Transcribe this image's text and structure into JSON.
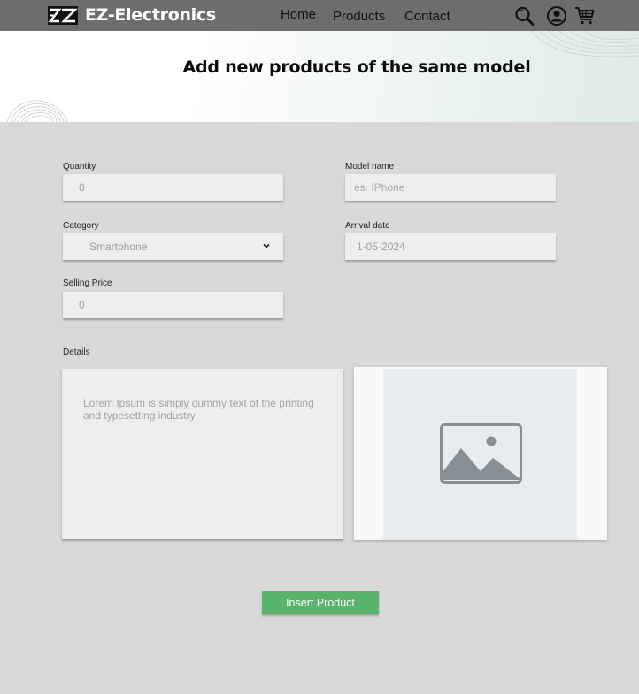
{
  "header": {
    "brand": "EZ-Electronics",
    "nav": {
      "home": "Home",
      "products": "Products",
      "contact": "Contact"
    },
    "icons": [
      "logo-icon",
      "search-icon",
      "user-icon",
      "cart-icon"
    ],
    "background_color": "#6d6d6d"
  },
  "hero": {
    "title": "Add new products of the same model"
  },
  "form": {
    "quantity": {
      "label": "Quantity",
      "value": "0"
    },
    "model_name": {
      "label": "Model name",
      "placeholder": "es. IPhone"
    },
    "category": {
      "label": "Category",
      "value": "Smartphone"
    },
    "arrival_date": {
      "label": "Arrival date",
      "value": "1-05-2024"
    },
    "selling_price": {
      "label": "Selling Price",
      "value": "0"
    },
    "details": {
      "label": "Details",
      "placeholder": "Lorem Ipsum is simply dummy text of the printing and typesetting industry."
    },
    "image_placeholder_icon": "image-icon",
    "submit_label": "Insert Product",
    "submit_color": "#58b36b"
  }
}
